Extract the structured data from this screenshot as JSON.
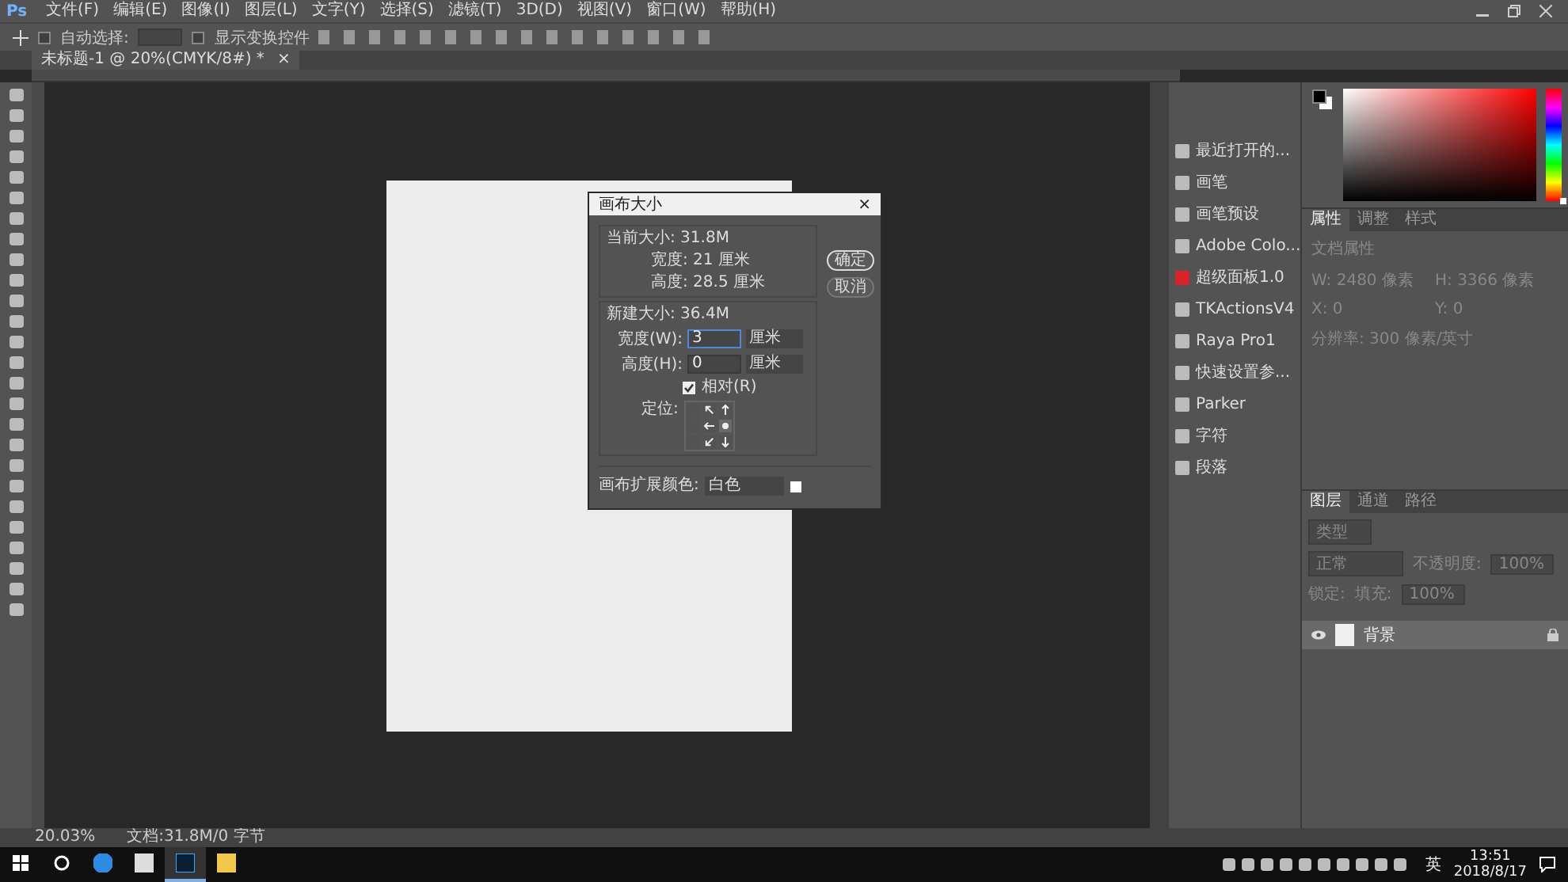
{
  "app": {
    "logo": "Ps"
  },
  "menu": [
    "文件(F)",
    "编辑(E)",
    "图像(I)",
    "图层(L)",
    "文字(Y)",
    "选择(S)",
    "滤镜(T)",
    "3D(D)",
    "视图(V)",
    "窗口(W)",
    "帮助(H)"
  ],
  "options": {
    "auto_select_label": "自动选择:",
    "auto_select_checked": false,
    "show_transform_label": "显示变换控件",
    "show_transform_checked": false
  },
  "document_tab": {
    "title": "未标题-1 @ 20%(CMYK/8#) *",
    "close": "×"
  },
  "dialog": {
    "title": "画布大小",
    "close": "×",
    "current_size": "当前大小: 31.8M",
    "current_width": "宽度: 21 厘米",
    "current_height": "高度: 28.5 厘米",
    "new_size": "新建大小: 36.4M",
    "fields": [
      {
        "label": "宽度(W):",
        "value": "3",
        "unit": "厘米",
        "focused": true
      },
      {
        "label": "高度(H):",
        "value": "0",
        "unit": "厘米",
        "focused": false
      }
    ],
    "relative": {
      "label": "相对(R)",
      "checked": true
    },
    "anchor_label": "定位:",
    "anchor_cells": [
      {
        "selected": false
      },
      {
        "selected": false
      },
      {
        "selected": false
      },
      {
        "selected": false
      },
      {
        "selected": false
      },
      {
        "selected": true
      },
      {
        "selected": false
      },
      {
        "selected": false
      },
      {
        "selected": false
      }
    ],
    "extension_label": "画布扩展颜色:",
    "extension_value": "白色",
    "buttons": [
      {
        "label": "确定",
        "selected": true
      },
      {
        "label": "取消",
        "selected": false
      }
    ]
  },
  "color_panel": {
    "hue": {
      "level": 0
    }
  },
  "dock": [
    {
      "label": "最近打开的..."
    },
    {
      "label": "画笔"
    },
    {
      "label": "画笔预设"
    },
    {
      "label": "Adobe Colo..."
    },
    {
      "label": "超级面板1.0"
    },
    {
      "label": "TKActionsV4"
    },
    {
      "label": "Raya Pro1"
    },
    {
      "label": "快速设置参..."
    },
    {
      "label": "Parker"
    },
    {
      "label": "字符"
    },
    {
      "label": "段落"
    }
  ],
  "properties": {
    "tabs": [
      {
        "label": "属性",
        "selected": true
      },
      {
        "label": "调整",
        "selected": false
      },
      {
        "label": "样式",
        "selected": false
      }
    ],
    "section": "文档属性",
    "fields": [
      "W: 2480 像素",
      "H: 3366 像素",
      "X: 0",
      "Y: 0"
    ],
    "resolution": "分辨率: 300 像素/英寸"
  },
  "layers": {
    "tabs": [
      {
        "label": "图层",
        "selected": true
      },
      {
        "label": "通道",
        "selected": false
      },
      {
        "label": "路径",
        "selected": false
      }
    ],
    "filter_placeholder": "类型",
    "blend_mode": "正常",
    "opacity_label": "不透明度:",
    "opacity": "100%",
    "lock_label": "锁定:",
    "fill_label": "填充:",
    "fill": "100%",
    "items": [
      {
        "name": "背景",
        "visible": true,
        "selected": true,
        "locked": true
      }
    ]
  },
  "status_bar": {
    "zoom": "20.03%",
    "doc_info": "文档:31.8M/0 字节"
  },
  "taskbar": {
    "apps": [
      {
        "kind": "edge",
        "selected": false
      },
      {
        "kind": "calculator",
        "selected": false
      },
      {
        "kind": "photoshop",
        "selected": true
      },
      {
        "kind": "folder",
        "selected": false
      }
    ],
    "ime": "英",
    "time": "13:51",
    "date": "2018/8/17"
  }
}
